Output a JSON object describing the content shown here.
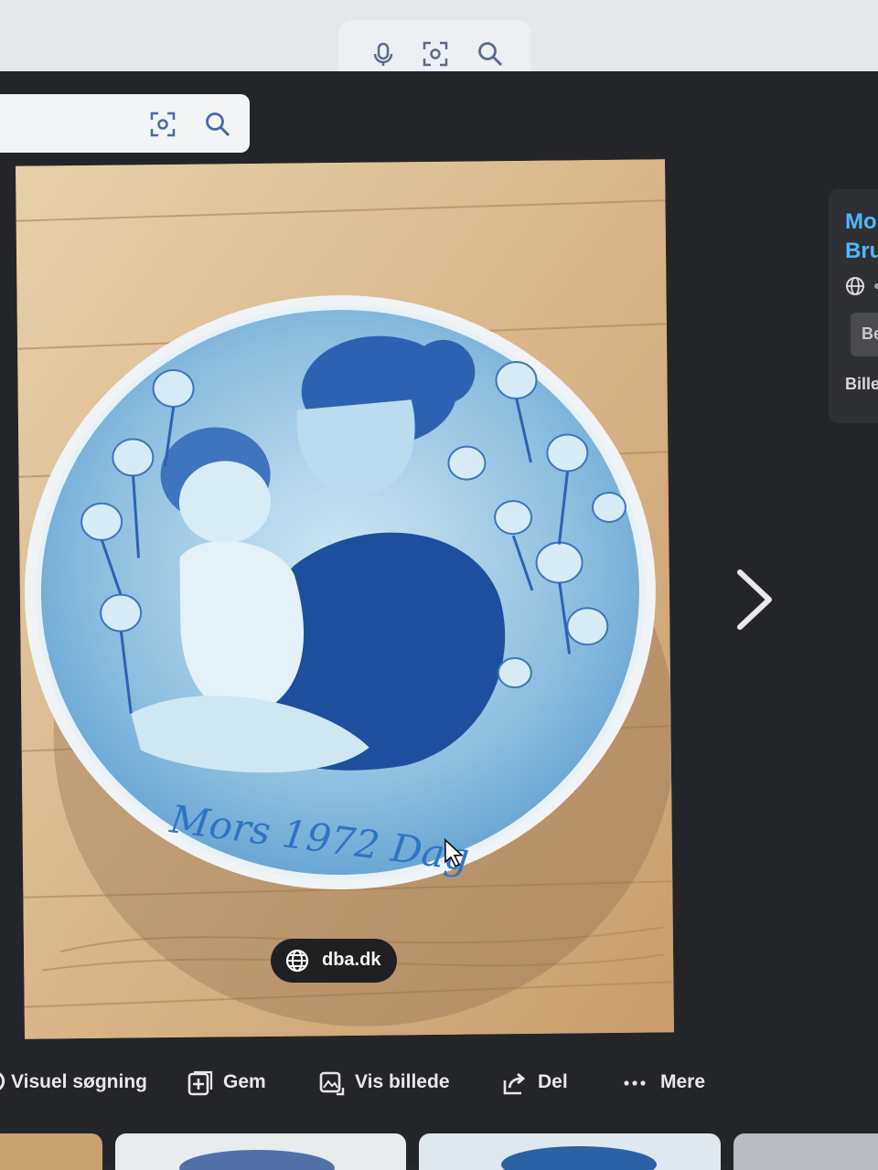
{
  "search": {
    "placeholder": ""
  },
  "image": {
    "plate_text": "Mors 1972 Dag",
    "source": "dba.dk"
  },
  "side_panel": {
    "title_line1": "Mo",
    "title_line2": "Bru",
    "button_label": "Be",
    "caption": "Bille"
  },
  "actions": [
    {
      "label": "Visuel søgning",
      "icon": "lens-icon"
    },
    {
      "label": "Gem",
      "icon": "bookmark-add-icon"
    },
    {
      "label": "Vis billede",
      "icon": "open-image-icon"
    },
    {
      "label": "Del",
      "icon": "share-icon"
    },
    {
      "label": "Mere",
      "icon": "more-dots-icon"
    }
  ],
  "colors": {
    "background": "#242528",
    "accent_title": "#4fb8ff",
    "plate_blue": "#1d4f9e",
    "plate_light": "#a9d2ea"
  }
}
